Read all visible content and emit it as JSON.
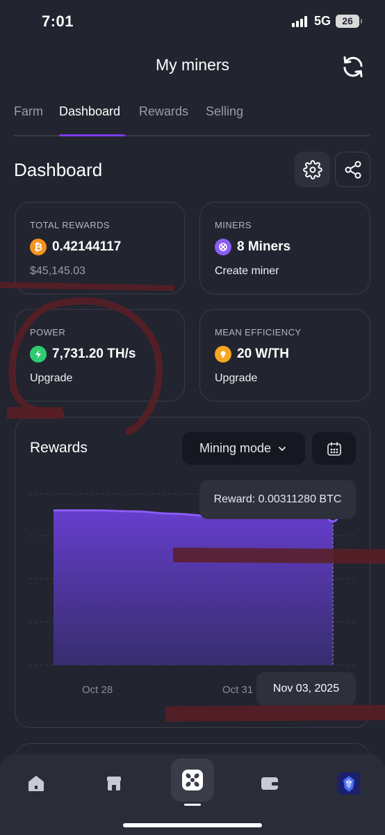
{
  "status_bar": {
    "time": "7:01",
    "network": "5G",
    "battery": "26"
  },
  "header": {
    "title": "My miners",
    "refresh_icon": "refresh-icon"
  },
  "tabs": [
    {
      "label": "Farm",
      "active": false
    },
    {
      "label": "Dashboard",
      "active": true
    },
    {
      "label": "Rewards",
      "active": false
    },
    {
      "label": "Selling",
      "active": false
    }
  ],
  "dashboard": {
    "title": "Dashboard",
    "settings_icon": "gear-icon",
    "share_icon": "share-icon"
  },
  "stats": {
    "total_rewards": {
      "label": "TOTAL REWARDS",
      "value": "0.42144117",
      "usd": "$45,145.03",
      "icon": "bitcoin-icon"
    },
    "miners": {
      "label": "MINERS",
      "value": "8 Miners",
      "link": "Create miner",
      "icon": "miner-icon"
    },
    "power": {
      "label": "POWER",
      "value": "7,731.20 TH/s",
      "link": "Upgrade",
      "icon": "lightning-icon"
    },
    "efficiency": {
      "label": "MEAN EFFICIENCY",
      "value": "20 W/TH",
      "link": "Upgrade",
      "icon": "bulb-icon"
    }
  },
  "chart": {
    "title": "Rewards",
    "mode_label": "Mining mode",
    "calendar_icon": "calendar-icon",
    "tooltip": "Reward: 0.00311280 BTC",
    "selected_date": "Nov 03, 2025",
    "x_ticks": [
      "Oct 28",
      "Oct 31"
    ]
  },
  "chart_data": {
    "type": "area",
    "x": [
      "Oct 27",
      "Oct 28",
      "Oct 29",
      "Oct 30",
      "Oct 31",
      "Nov 01",
      "Nov 02",
      "Nov 03"
    ],
    "series": [
      {
        "values": [
          0.00324,
          0.00324,
          0.00322,
          0.00317,
          0.00312,
          0.00312,
          0.00312,
          0.0031128
        ]
      }
    ],
    "color": "#7c3aed",
    "grid": true
  },
  "bottom_nav": {
    "items": [
      {
        "icon": "home-icon"
      },
      {
        "icon": "store-icon"
      },
      {
        "icon": "fan-icon",
        "active": true
      },
      {
        "icon": "wallet-icon"
      },
      {
        "icon": "avatar-icon"
      }
    ]
  },
  "colors": {
    "accent": "#7c3aed",
    "background": "#22242f",
    "bitcoin": "#f7931a",
    "power": "#2ecc71",
    "efficiency": "#f4a721",
    "miners": "#8b5cf6"
  }
}
